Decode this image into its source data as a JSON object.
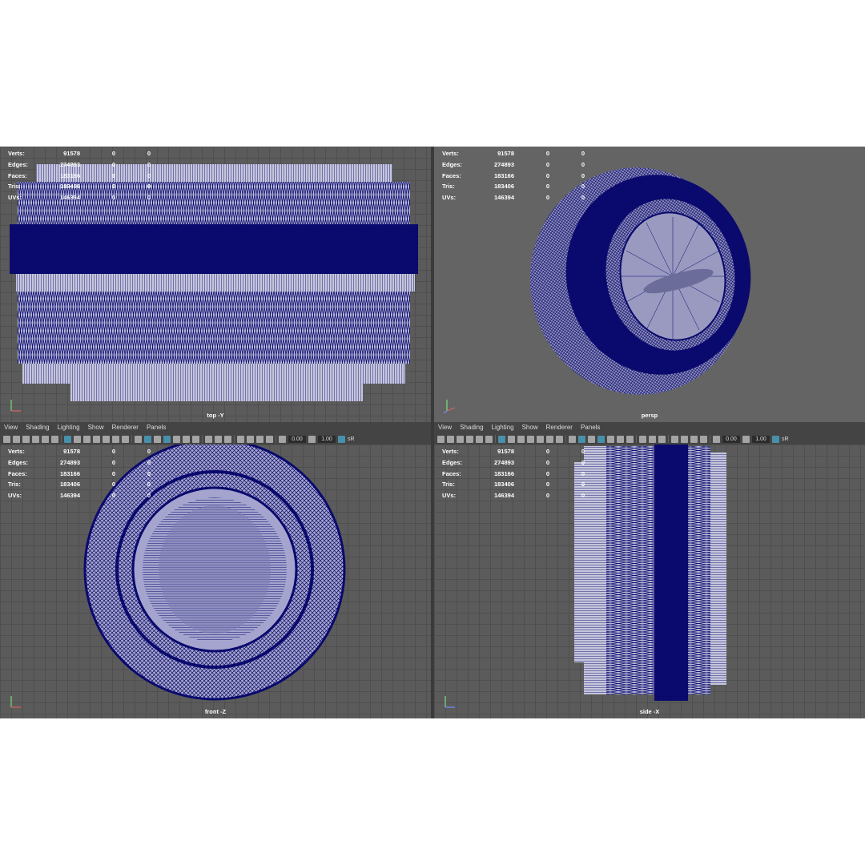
{
  "stats": {
    "rows": [
      {
        "label": "Verts:",
        "v1": "91578",
        "v2": "0",
        "v3": "0"
      },
      {
        "label": "Edges:",
        "v1": "274893",
        "v2": "0",
        "v3": "0"
      },
      {
        "label": "Faces:",
        "v1": "183166",
        "v2": "0",
        "v3": "0"
      },
      {
        "label": "Tris:",
        "v1": "183406",
        "v2": "0",
        "v3": "0"
      },
      {
        "label": "UVs:",
        "v1": "146394",
        "v2": "0",
        "v3": "0"
      }
    ]
  },
  "viewports": {
    "top": {
      "label": "top -Y"
    },
    "persp": {
      "label": "persp"
    },
    "front": {
      "label": "front -Z"
    },
    "side": {
      "label": "side -X"
    }
  },
  "panel_menu": [
    "View",
    "Shading",
    "Lighting",
    "Show",
    "Renderer",
    "Panels"
  ],
  "toolbar": {
    "field_a": "0.00",
    "field_b": "1.00",
    "suffix": "sR"
  },
  "colors": {
    "wireframe": "#0a0a6e",
    "background": "#5b5b5b",
    "accent": "#4aa3c7"
  },
  "icons": [
    "camera-icon",
    "grid-icon",
    "wireframe-shading-icon",
    "smooth-shading-icon",
    "light-icon",
    "isolate-icon",
    "exposure-icon",
    "gamma-icon"
  ]
}
